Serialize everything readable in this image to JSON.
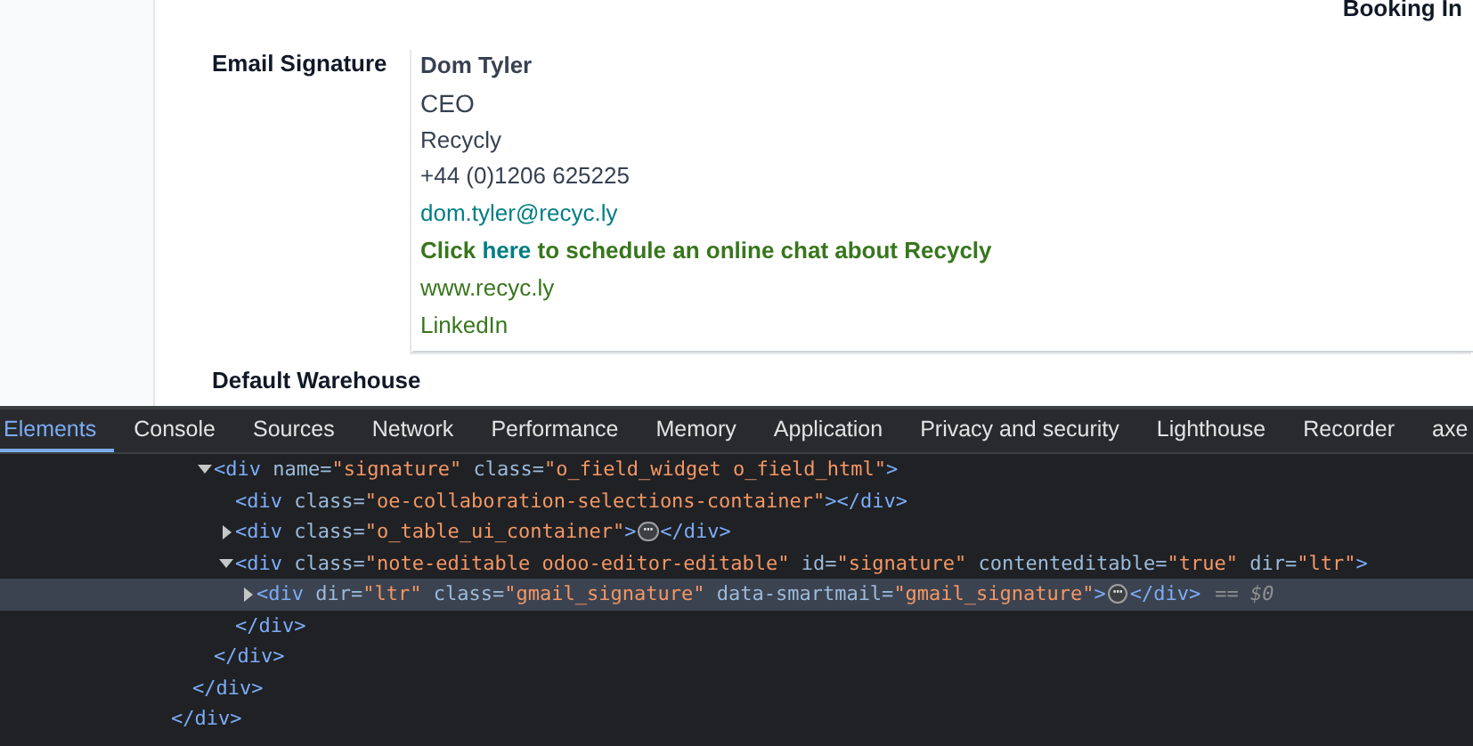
{
  "form": {
    "corner_label": "Booking In",
    "fields": [
      {
        "label": "Email Signature",
        "signature": [
          {
            "kind": "name",
            "parts": [
              {
                "text": "Dom Tyler"
              }
            ]
          },
          {
            "kind": "title",
            "parts": [
              {
                "text": "CEO"
              }
            ]
          },
          {
            "kind": "text",
            "parts": [
              {
                "text": "Recycly"
              }
            ]
          },
          {
            "kind": "text",
            "parts": [
              {
                "text": "+44 (0)1206 625225"
              }
            ]
          },
          {
            "kind": "email",
            "parts": [
              {
                "text": "dom.tyler@recyc.ly"
              }
            ]
          },
          {
            "kind": "cta",
            "parts": [
              {
                "text": "Click "
              },
              {
                "text": "here",
                "link": true
              },
              {
                "text": " to schedule an online chat about Recycly"
              }
            ]
          },
          {
            "kind": "website",
            "parts": [
              {
                "text": "www.recyc.ly"
              }
            ]
          },
          {
            "kind": "website",
            "parts": [
              {
                "text": "LinkedIn"
              }
            ]
          }
        ]
      },
      {
        "label": "Default Warehouse"
      }
    ]
  },
  "devtools": {
    "tabs": [
      {
        "label": "Elements",
        "selected": true
      },
      {
        "label": "Console",
        "selected": false
      },
      {
        "label": "Sources",
        "selected": false
      },
      {
        "label": "Network",
        "selected": false
      },
      {
        "label": "Performance",
        "selected": false
      },
      {
        "label": "Memory",
        "selected": false
      },
      {
        "label": "Application",
        "selected": false
      },
      {
        "label": "Privacy and security",
        "selected": false
      },
      {
        "label": "Lighthouse",
        "selected": false
      },
      {
        "label": "Recorder",
        "selected": false
      },
      {
        "label": "axe",
        "selected": false
      }
    ],
    "dom_tree": [
      {
        "selected": false,
        "close": "</div>",
        "children": [
          {
            "selected": false,
            "close": "</div>",
            "children": [
              {
                "tag": "<div",
                "attributes": [
                  {
                    "name": "name=",
                    "value": "\"signature\""
                  },
                  {
                    "name": "class=",
                    "value": "\"o_field_widget o_field_html\""
                  }
                ],
                "end": ">",
                "expanded": true,
                "selected": false,
                "close": "</div>",
                "children": [
                  {
                    "tag": "<div",
                    "attributes": [
                      {
                        "name": "class=",
                        "value": "\"oe-collaboration-selections-container\""
                      }
                    ],
                    "end": ">",
                    "selected": false,
                    "close": "</div>"
                  },
                  {
                    "tag": "<div",
                    "attributes": [
                      {
                        "name": "class=",
                        "value": "\"o_table_ui_container\""
                      }
                    ],
                    "end": ">",
                    "expanded": false,
                    "ellipsis": "⋯",
                    "selected": false,
                    "close": "</div>"
                  },
                  {
                    "tag": "<div",
                    "attributes": [
                      {
                        "name": "class=",
                        "value": "\"note-editable odoo-editor-editable\""
                      },
                      {
                        "name": "id=",
                        "value": "\"signature\""
                      },
                      {
                        "name": "contenteditable=",
                        "value": "\"true\""
                      },
                      {
                        "name": "dir=",
                        "value": "\"ltr\""
                      }
                    ],
                    "end": ">",
                    "expanded": true,
                    "selected": false,
                    "close": "</div>",
                    "children": [
                      {
                        "tag": "<div",
                        "attributes": [
                          {
                            "name": "dir=",
                            "value": "\"ltr\""
                          },
                          {
                            "name": "class=",
                            "value": "\"gmail_signature\""
                          },
                          {
                            "name": "data-smartmail=",
                            "value": "\"gmail_signature\""
                          }
                        ],
                        "end": ">",
                        "expanded": false,
                        "ellipsis": "⋯",
                        "selected": true,
                        "console_ref": "== $0",
                        "close": "</div>"
                      }
                    ]
                  }
                ]
              }
            ]
          }
        ]
      }
    ]
  }
}
